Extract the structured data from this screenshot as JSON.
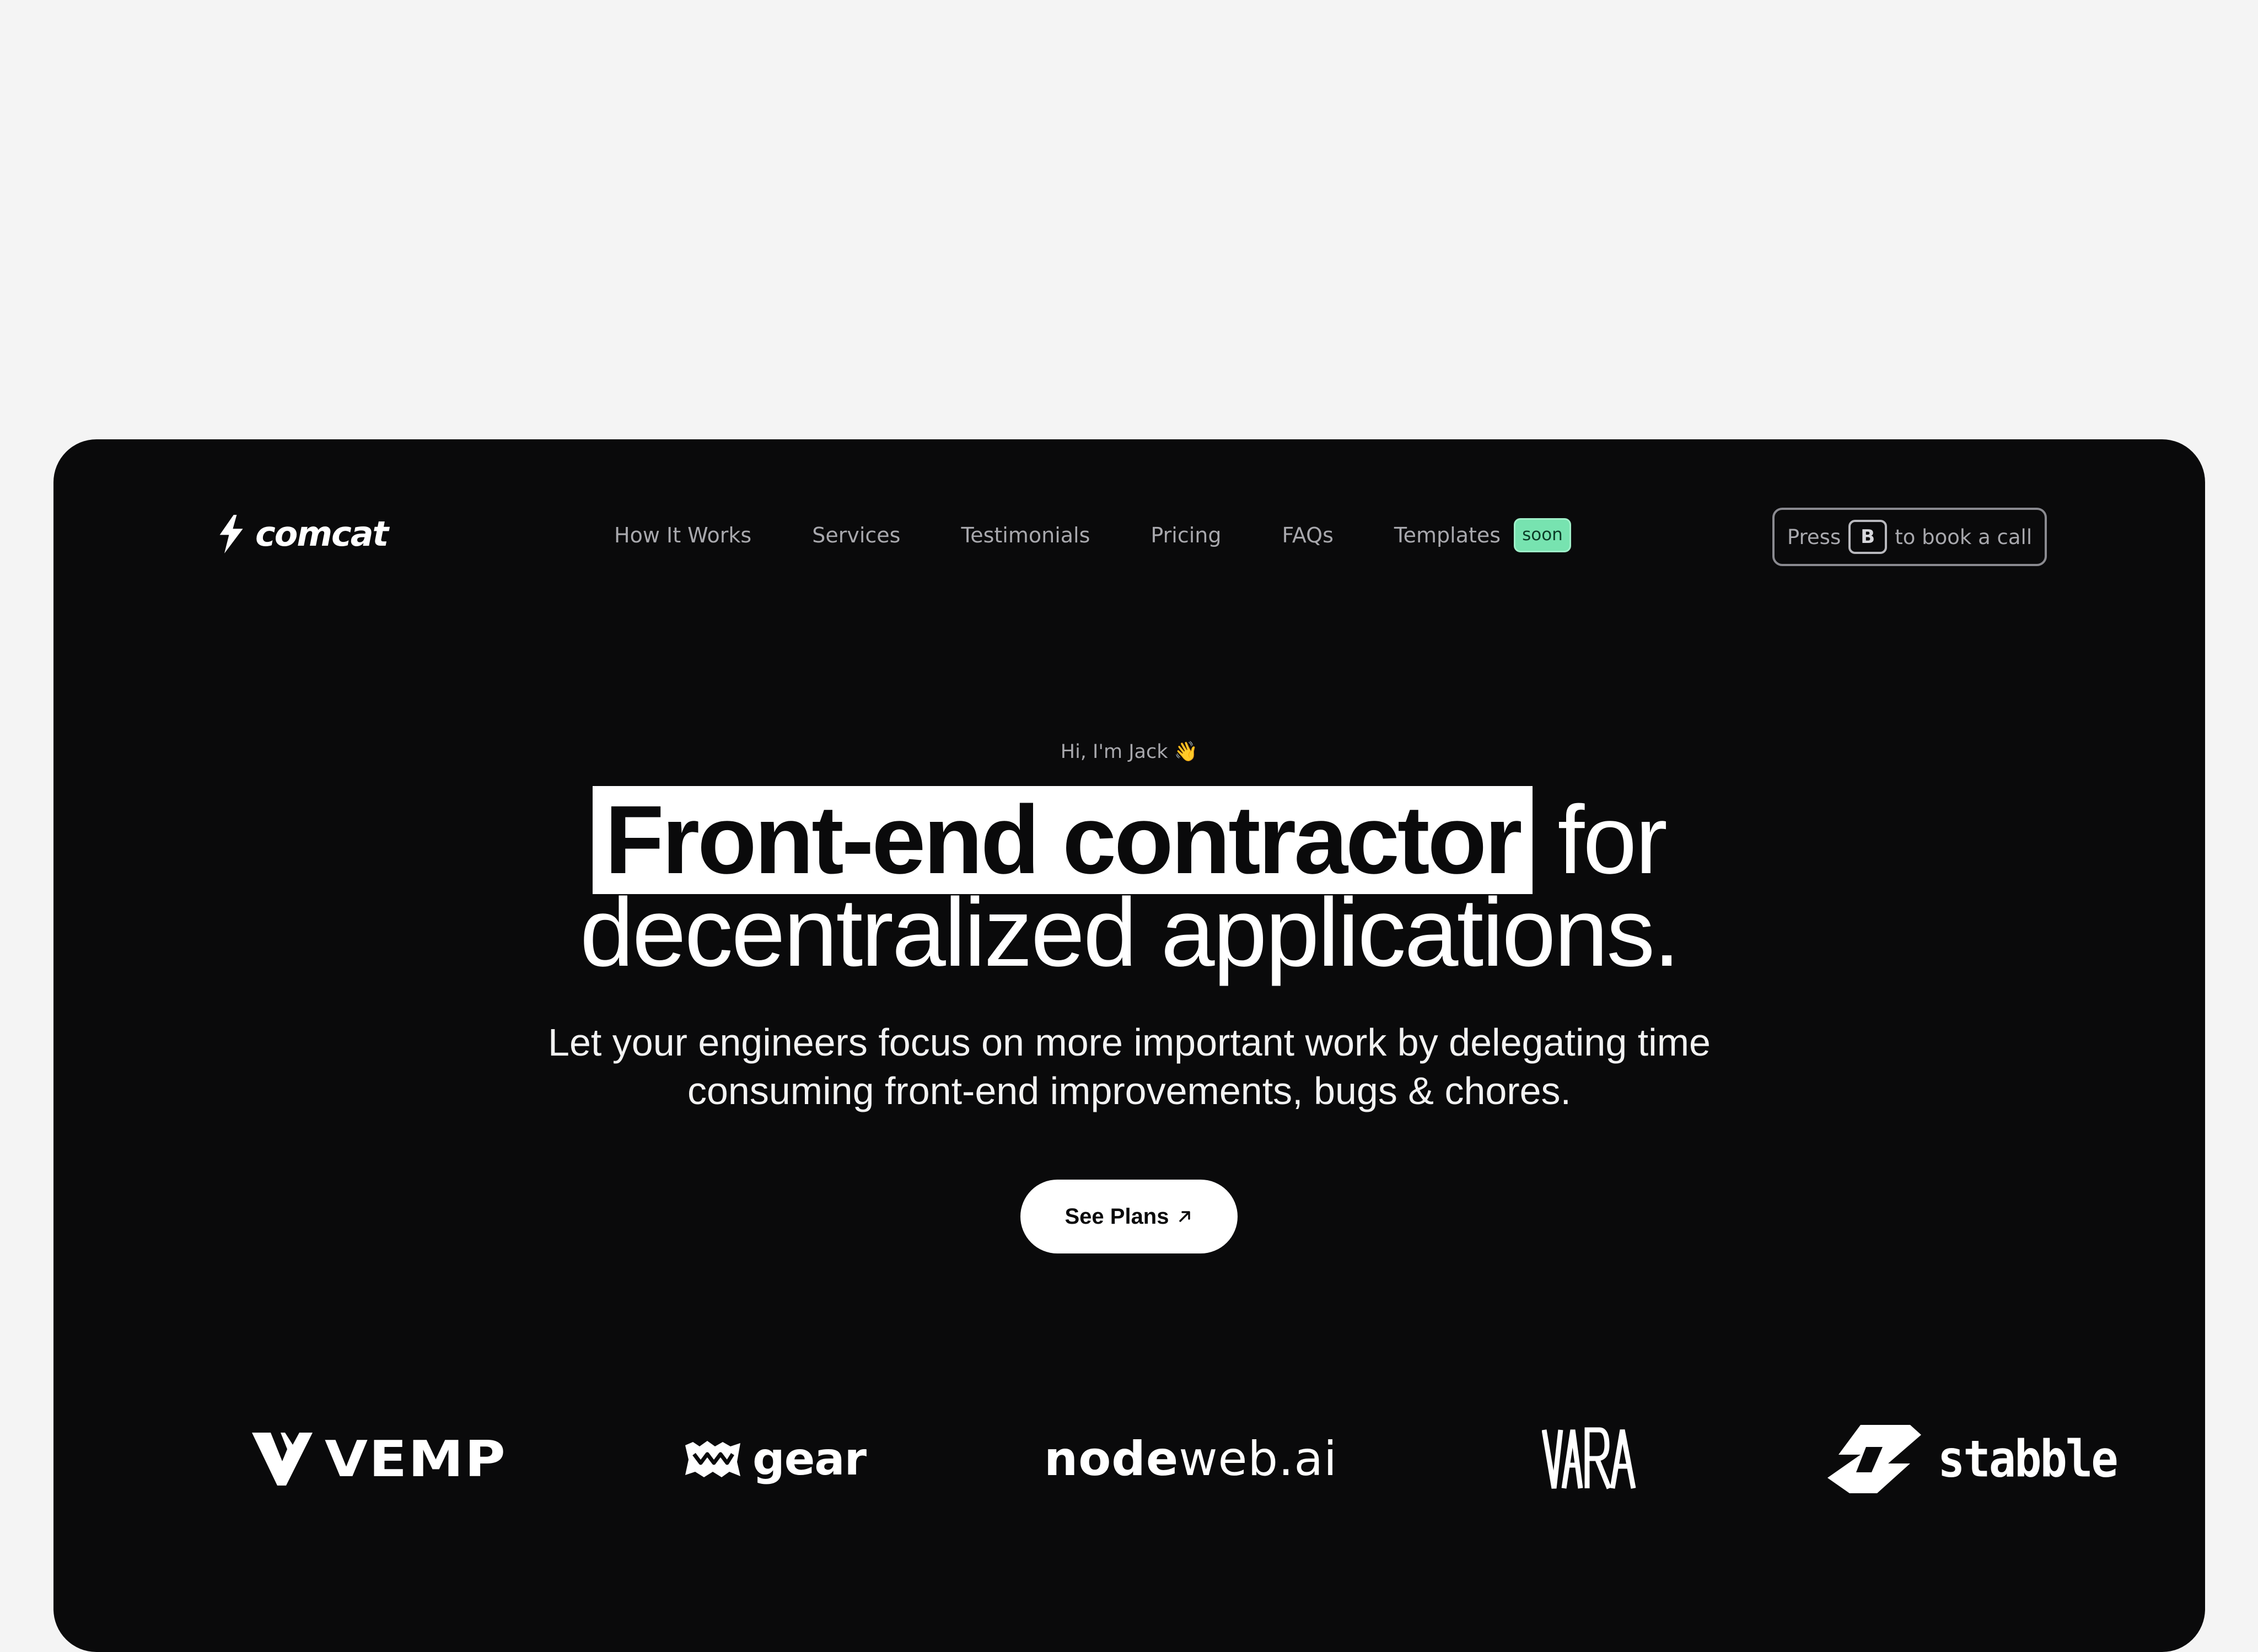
{
  "brand": {
    "name": "comcat",
    "icon": "lightning-bolt-icon"
  },
  "nav": {
    "items": [
      {
        "label": "How It Works"
      },
      {
        "label": "Services"
      },
      {
        "label": "Testimonials"
      },
      {
        "label": "Pricing"
      },
      {
        "label": "FAQs"
      },
      {
        "label": "Templates",
        "badge": "soon"
      }
    ]
  },
  "book_call": {
    "prefix": "Press",
    "key": "B",
    "suffix": "to book a call"
  },
  "hero": {
    "greeting": "Hi, I'm Jack 👋",
    "headline_highlight": "Front-end contractor",
    "headline_rest_line1": " for",
    "headline_line2": "decentralized applications.",
    "subhead_line1": "Let your engineers focus on more important work by delegating time",
    "subhead_line2": "consuming front-end improvements, bugs & chores.",
    "cta_label": "See Plans",
    "cta_icon": "arrow-up-right-icon"
  },
  "logos": [
    {
      "name": "VEMP"
    },
    {
      "name": "gear"
    },
    {
      "name": "nodeweb.ai"
    },
    {
      "name": "VARA"
    },
    {
      "name": "stabble"
    }
  ],
  "colors": {
    "page_background": "#f4f4f4",
    "panel_background": "#0a0a0b",
    "nav_text": "#a8a8ad",
    "badge_background": "#77e3b0",
    "badge_text": "#0c3b27",
    "primary_text": "#ffffff",
    "cta_background": "#ffffff",
    "cta_text": "#0a0a0b"
  }
}
